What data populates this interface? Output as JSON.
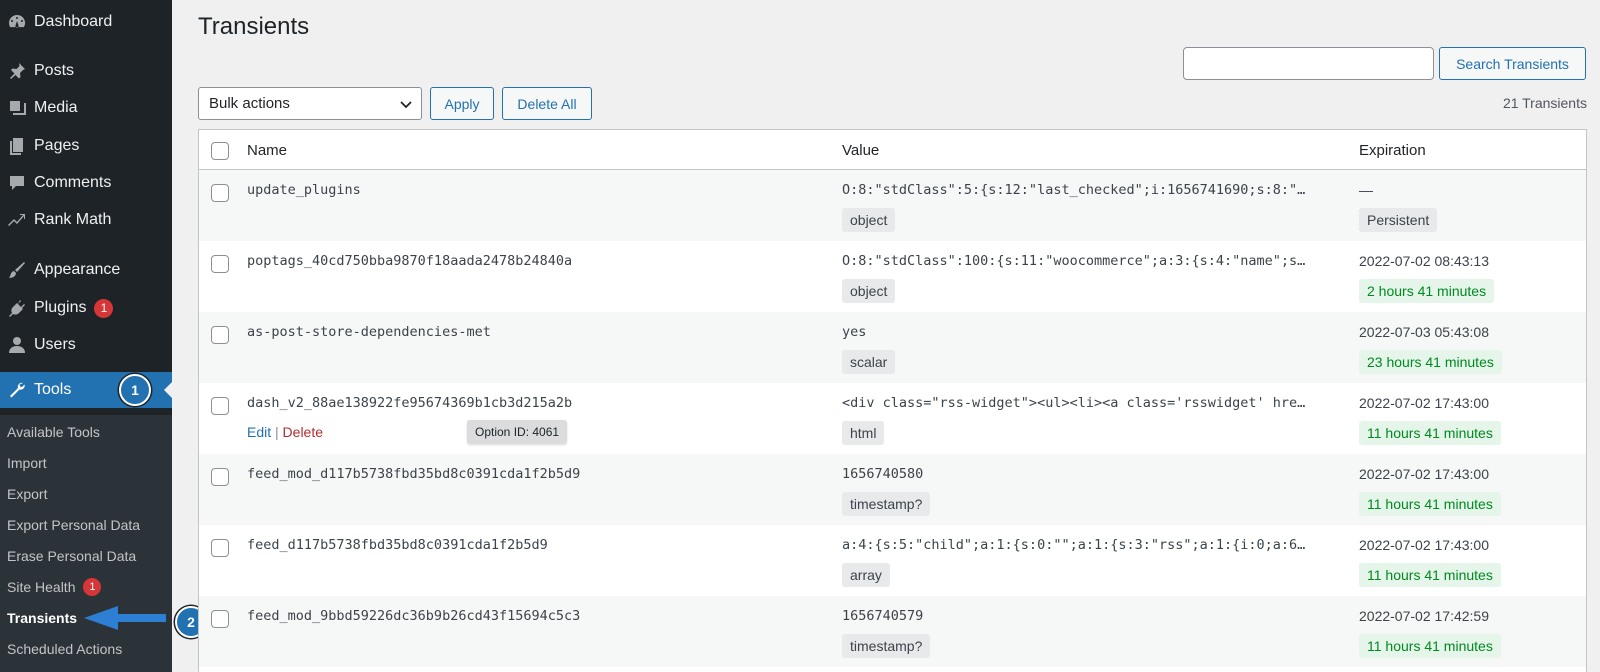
{
  "sidebar": {
    "items": [
      {
        "label": "Dashboard",
        "icon": "dashboard-icon"
      },
      {
        "label": "Posts",
        "icon": "pin-icon"
      },
      {
        "label": "Media",
        "icon": "media-icon"
      },
      {
        "label": "Pages",
        "icon": "pages-icon"
      },
      {
        "label": "Comments",
        "icon": "comment-icon"
      },
      {
        "label": "Rank Math",
        "icon": "chart-icon"
      },
      {
        "label": "Appearance",
        "icon": "brush-icon"
      },
      {
        "label": "Plugins",
        "icon": "plug-icon",
        "badge": "1"
      },
      {
        "label": "Users",
        "icon": "user-icon"
      },
      {
        "label": "Tools",
        "icon": "wrench-icon",
        "active": true
      }
    ],
    "submenu": [
      {
        "label": "Available Tools"
      },
      {
        "label": "Import"
      },
      {
        "label": "Export"
      },
      {
        "label": "Export Personal Data"
      },
      {
        "label": "Erase Personal Data"
      },
      {
        "label": "Site Health",
        "badge": "1"
      },
      {
        "label": "Transients",
        "current": true
      },
      {
        "label": "Scheduled Actions"
      }
    ],
    "step_markers": [
      "1",
      "2"
    ]
  },
  "page": {
    "title": "Transients",
    "search_button": "Search Transients",
    "bulk_select": "Bulk actions",
    "apply_button": "Apply",
    "delete_all_button": "Delete All",
    "count": "21 Transients"
  },
  "table": {
    "headers": {
      "name": "Name",
      "value": "Value",
      "expiration": "Expiration"
    },
    "rows": [
      {
        "name": "update_plugins",
        "value": "O:8:\"stdClass\":5:{s:12:\"last_checked\";i:1656741690;s:8:\"…",
        "type": "object",
        "expiration": "—",
        "status": "Persistent"
      },
      {
        "name": "poptags_40cd750bba9870f18aada2478b24840a",
        "value": "O:8:\"stdClass\":100:{s:11:\"woocommerce\";a:3:{s:4:\"name\";s…",
        "type": "object",
        "expiration": "2022-07-02 08:43:13",
        "status": "2 hours 41 minutes"
      },
      {
        "name": "as-post-store-dependencies-met",
        "value": "yes",
        "type": "scalar",
        "expiration": "2022-07-03 05:43:08",
        "status": "23 hours 41 minutes"
      },
      {
        "name": "dash_v2_88ae138922fe95674369b1cb3d215a2b",
        "value": "<div class=\"rss-widget\"><ul><li><a class='rsswidget' hre…",
        "type": "html",
        "expiration": "2022-07-02 17:43:00",
        "status": "11 hours 41 minutes",
        "actions": {
          "edit": "Edit",
          "sep": "|",
          "delete": "Delete"
        },
        "tooltip": "Option ID: 4061"
      },
      {
        "name": "feed_mod_d117b5738fbd35bd8c0391cda1f2b5d9",
        "value": "1656740580",
        "type": "timestamp?",
        "expiration": "2022-07-02 17:43:00",
        "status": "11 hours 41 minutes"
      },
      {
        "name": "feed_d117b5738fbd35bd8c0391cda1f2b5d9",
        "value": "a:4:{s:5:\"child\";a:1:{s:0:\"\";a:1:{s:3:\"rss\";a:1:{i:0;a:6…",
        "type": "array",
        "expiration": "2022-07-02 17:43:00",
        "status": "11 hours 41 minutes"
      },
      {
        "name": "feed_mod_9bbd59226dc36b9b26cd43f15694c5c3",
        "value": "1656740579",
        "type": "timestamp?",
        "expiration": "2022-07-02 17:42:59",
        "status": "11 hours 41 minutes"
      }
    ]
  },
  "colors": {
    "accent": "#2271b1",
    "sidebar": "#1d2327",
    "badge": "#d63638",
    "success": "#008a20",
    "delete": "#b32d2e"
  }
}
